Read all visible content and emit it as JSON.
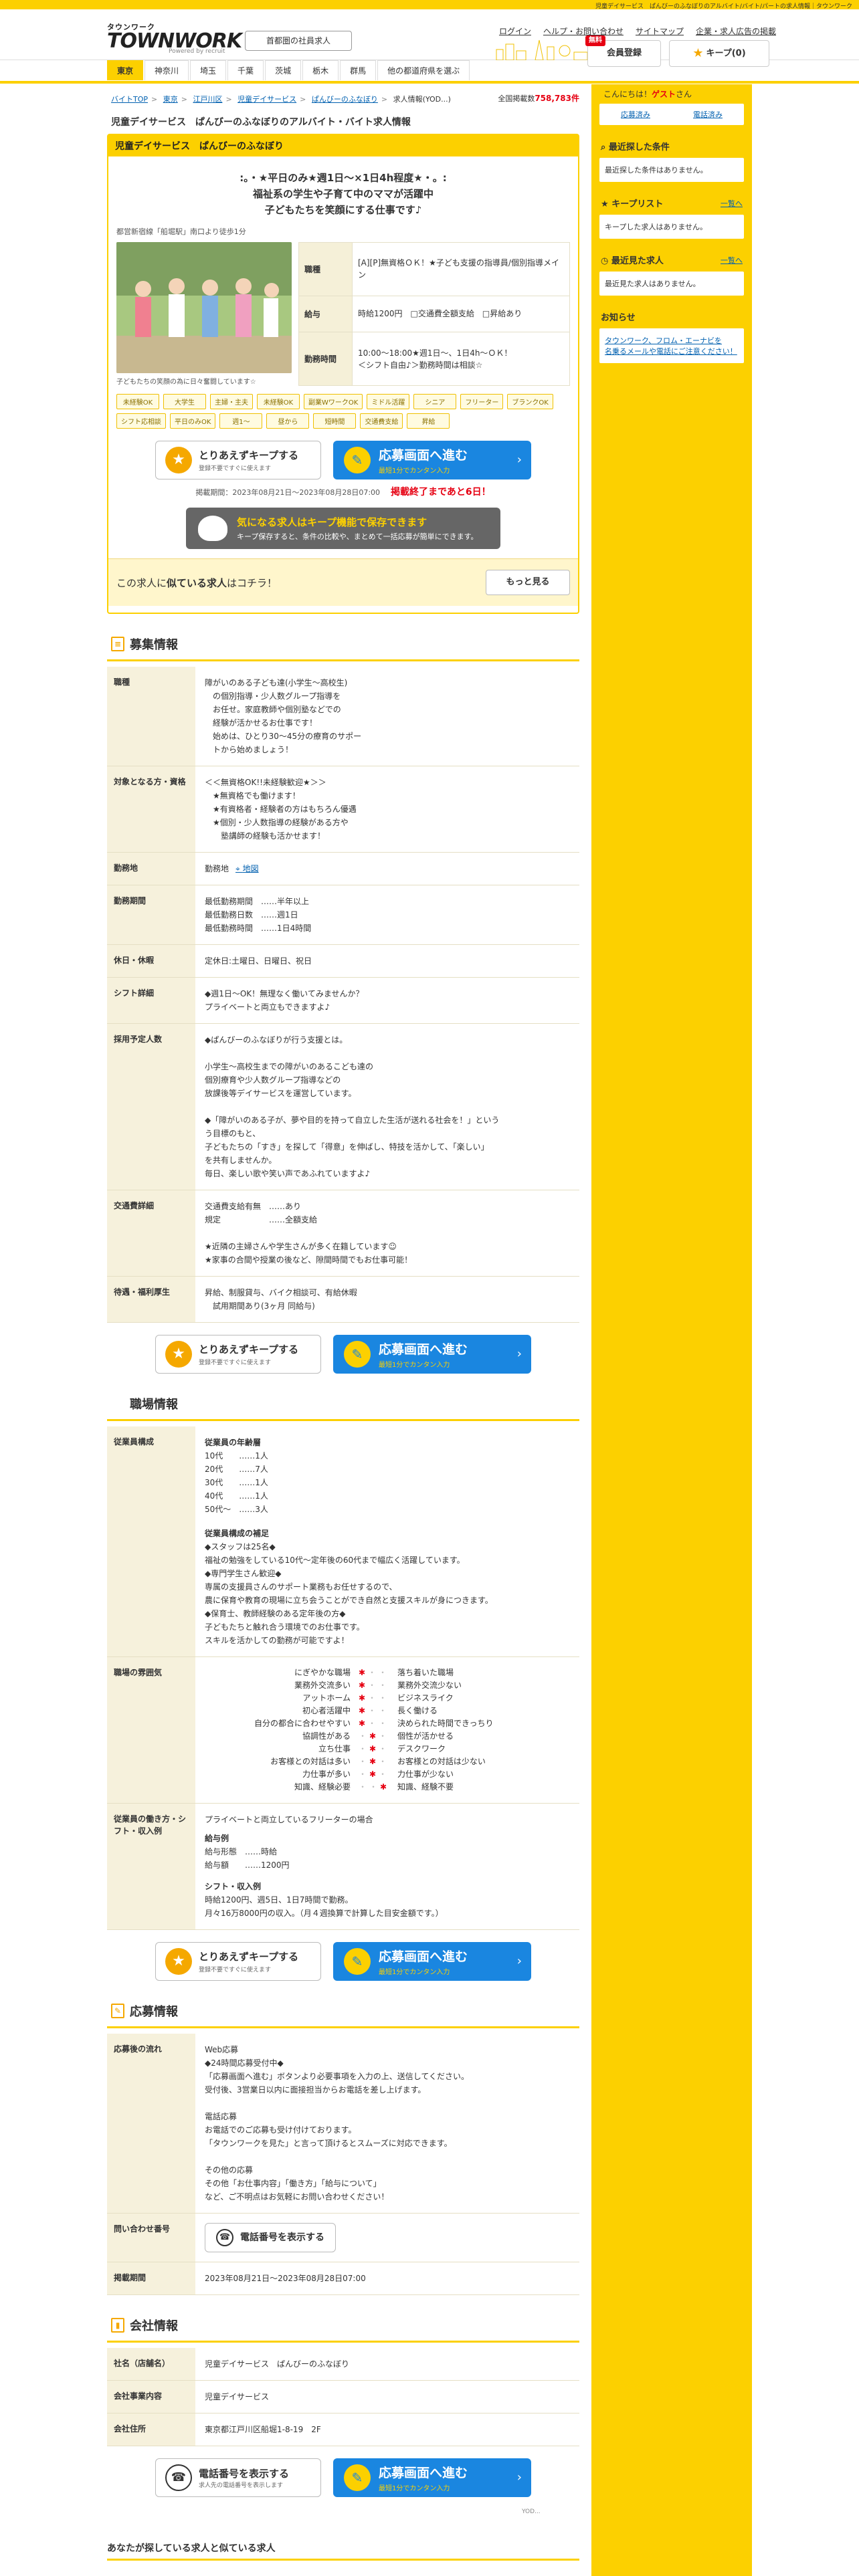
{
  "topbar": "児童デイサービス　ぱんびーのふなぼりのアルバイト/バイト/パートの求人情報｜タウンワーク",
  "header": {
    "logo_small": "タウンワーク",
    "logo_big": "TOWNWORK",
    "logo_by": "Powered by recruit",
    "store_link": "首都圏の社員求人",
    "links": [
      "ログイン",
      "ヘルプ・お問い合わせ",
      "サイトマップ",
      "企業・求人広告の掲載"
    ],
    "register_badge": "無料",
    "register_label": "会員登録",
    "keep_label": "キープ(0)"
  },
  "nav": [
    "東京",
    "神奈川",
    "埼玉",
    "千葉",
    "茨城",
    "栃木",
    "群馬",
    "他の都道府県を選ぶ"
  ],
  "breadcrumb": [
    "バイトTOP",
    "東京",
    "江戸川区",
    "児童デイサービス",
    "ぱんびーのふなぼり",
    "求人情報(YOD...)"
  ],
  "total": {
    "label": "全国掲載数",
    "value": "758,783件"
  },
  "page_title": "児童デイサービス　ぱんびーのふなぼりのアルバイト・バイト求人情報",
  "job": {
    "company": "児童デイサービス　ぱんびーのふなぼり",
    "catch": ":。・★平日のみ★週1日〜×1日4h程度★・。:\n福祉系の学生や子育て中のママが活躍中\n子どもたちを笑顔にする仕事です♪",
    "station": "都営新宿線「船堀駅」南口より徒歩1分",
    "photo_caption": "子どもたちの笑顔の為に日々奮闘しています☆",
    "summary": [
      {
        "th": "職種",
        "td": "[A][P]無資格ＯＫ！★子ども支援の指導員/個別指導メイン"
      },
      {
        "th": "給与",
        "td": "時給1200円　□交通費全額支給　□昇給あり"
      },
      {
        "th": "勤務時間",
        "td": "10:00〜18:00★週1日〜、1日4h〜ＯＫ！\n＜シフト自由♪＞勤務時間は相談☆"
      }
    ],
    "tags": [
      "未経験OK",
      "大学生",
      "主婦・主夫",
      "未経験OK",
      "副業WワークOK",
      "ミドル活躍",
      "シニア",
      "フリーター",
      "ブランクOK",
      "シフト応相談",
      "平日のみOK",
      "週1～",
      "昼から",
      "短時間",
      "交通費支給",
      "昇給"
    ],
    "keep_btn": {
      "t1": "とりあえずキープする",
      "t2": "登録不要ですぐに使えます"
    },
    "apply_btn": {
      "t1": "応募画面へ進む",
      "t2": "最短1分でカンタン入力"
    },
    "period": "掲載期間：2023年08月21日〜2023年08月28日07:00",
    "deadline": "掲載終了まであと6日！",
    "keep_banner": {
      "t1": "気になる求人はキープ機能で保存できます",
      "t2": "キープ保存すると、条件の比較や、まとめて一括応募が簡単にできます。"
    },
    "similar": {
      "prefix": "この求人に",
      "bold": "似ている求人",
      "suffix": "はコチラ！",
      "more": "もっと見る"
    }
  },
  "recruit": {
    "heading": "募集情報",
    "rows": [
      {
        "th": "職種",
        "td": "障がいのある子ども達(小学生〜高校生)\n　の個別指導・少人数グループ指導を\n　お任せ。家庭教師や個別塾などでの\n　経験が活かせるお仕事です！\n　始めは、ひとり30〜45分の療育のサポー\n　トから始めましょう！"
      },
      {
        "th": "対象となる方・資格",
        "td": "＜＜無資格OK!!未経験歓迎★＞＞\n　★無資格でも働けます！\n　★有資格者・経験者の方はもちろん優遇\n　★個別・少人数指導の経験がある方や\n　　塾講師の経験も活かせます！"
      },
      {
        "th": "勤務地",
        "td": "勤務地",
        "map": "地図"
      },
      {
        "th": "勤務期間",
        "td": "最低勤務期間　……半年以上\n最低勤務日数　……週1日\n最低勤務時間　……1日4時間"
      },
      {
        "th": "休日・休暇",
        "td": "定休日:土曜日、日曜日、祝日"
      },
      {
        "th": "シフト詳細",
        "td": "◆週1日〜OK！無理なく働いてみませんか？\nプライベートと両立もできますよ♪"
      },
      {
        "th": "採用予定人数",
        "td": "◆ぱんびーのふなぼりが行う支援とは。\n\n小学生〜高校生までの障がいのあるこども達の\n個別療育や少人数グループ指導などの\n放課後等デイサービスを運営しています。\n\n◆「障がいのある子が、夢や目的を持って自立した生活が送れる社会を！」という\nう目標のもと、\n子どもたちの「すき」を探して「得意」を伸ばし、特技を活かして、「楽しい」\nを共有しませんか。\n毎日、楽しい歌や笑い声であふれていますよ♪"
      },
      {
        "th": "交通費詳細",
        "td": "交通費支給有無　……あり\n規定　　　　　　……全額支給\n\n★近隣の主婦さんや学生さんが多く在籍しています☺\n★家事の合間や授業の後など、隙間時間でもお仕事可能！"
      },
      {
        "th": "待遇・福利厚生",
        "td": "昇給、制服貸与、バイク相談可、有給休暇\n　試用期間あり(3ヶ月 同給与)"
      }
    ]
  },
  "workplace": {
    "heading": "職場情報",
    "staff_th": "従業員構成",
    "staff_age_title": "従業員の年齢層",
    "ages": [
      "10代　　……1人",
      "20代　　……7人",
      "30代　　……1人",
      "40代　　……1人",
      "50代〜　……3人"
    ],
    "staff_note_title": "従業員構成の補足",
    "staff_note": "◆スタッフは25名◆\n福祉の勉強をしている10代〜定年後の60代まで幅広く活躍しています。\n◆専門学生さん歓迎◆\n専属の支援員さんのサポート業務もお任せするので、\n農に保育や教育の現場に立ち会うことができ自然と支援スキルが身につきます。\n◆保育士、教師経験のある定年後の方◆\n子どもたちと触れ合う環境でのお仕事です。\nスキルを活かしての勤務が可能ですよ！",
    "atmos_th": "職場の雰囲気",
    "atmos": [
      {
        "l": "にぎやかな職場",
        "pos": 1,
        "r": "落ち着いた職場"
      },
      {
        "l": "業務外交流多い",
        "pos": 1,
        "r": "業務外交流少ない"
      },
      {
        "l": "アットホーム",
        "pos": 1,
        "r": "ビジネスライク"
      },
      {
        "l": "初心者活躍中",
        "pos": 1,
        "r": "長く働ける"
      },
      {
        "l": "自分の都合に合わせやすい",
        "pos": 1,
        "r": "決められた時間できっちり"
      },
      {
        "l": "協調性がある",
        "pos": 2,
        "r": "個性が活かせる"
      },
      {
        "l": "立ち仕事",
        "pos": 2,
        "r": "デスクワーク"
      },
      {
        "l": "お客様との対話は多い",
        "pos": 2,
        "r": "お客様との対話は少ない"
      },
      {
        "l": "力仕事が多い",
        "pos": 2,
        "r": "力仕事が少ない"
      },
      {
        "l": "知識、経験必要",
        "pos": 3,
        "r": "知識、経験不要"
      }
    ],
    "style_th": "従業員の働き方・シフト・収入例",
    "style_text": "プライベートと両立しているフリーターの場合",
    "salary_title": "給与例",
    "salary": "給与形態　……時給\n給与額　　……1200円",
    "shift_title": "シフト・収入例",
    "shift": "時給1200円、週5日、1日7時間で勤務。\n月々16万8000円の収入。（月４週換算で計算した目安金額です。）"
  },
  "apply": {
    "heading": "応募情報",
    "flow_th": "応募後の流れ",
    "flow": "Web応募\n◆24時間応募受付中◆\n「応募画面へ進む」ボタンより必要事項を入力の上、送信してください。\n受付後、3営業日以内に面接担当からお電話を差し上げます。\n\n電話応募\nお電話でのご応募も受け付けております。\n「タウンワークを見た」と言って頂けるとスムーズに対応できます。\n\nその他の応募\nその他「お仕事内容」「働き方」「給与について」\nなど、ご不明点はお気軽にお問い合わせください！",
    "contact_th": "問い合わせ番号",
    "phone_btn": "電話番号を表示する",
    "period_th": "掲載期間",
    "period": "2023年08月21日〜2023年08月28日07:00"
  },
  "company": {
    "heading": "会社情報",
    "rows": [
      {
        "th": "社名（店舗名）",
        "td": "児童デイサービス　ぱんびーのふなぼり"
      },
      {
        "th": "会社事業内容",
        "td": "児童デイサービス"
      },
      {
        "th": "会社住所",
        "td": "東京都江戸川区船堀1-8-19　2F"
      }
    ],
    "phone_btn": {
      "t1": "電話番号を表示する",
      "t2": "求人先の電話番号を表示します"
    }
  },
  "footer_code": "YOD...",
  "bottom_heading": "あなたが探している求人と似ている求人",
  "sidebar": {
    "hello": "こんにちは！",
    "guest": "ゲスト",
    "san": "さん",
    "tabs": [
      "応募済み",
      "電話済み"
    ],
    "recent_cond_title": "最近探した条件",
    "recent_cond_text": "最近探した条件はありません。",
    "keeplist_title": "キープリスト",
    "keeplist_more": "一覧へ",
    "keeplist_text": "キープした求人はありません。",
    "recent_seen_title": "最近見た求人",
    "recent_seen_more": "一覧へ",
    "recent_seen_text": "最近見た求人はありません。",
    "notice_title": "お知らせ",
    "notice_text": "タウンワーク、フロム・エーナビを\n名乗るメールや電話にご注意ください！"
  },
  "colors": {
    "accent": "#fcd000",
    "apply": "#1a86e0",
    "alert": "#e60012"
  }
}
